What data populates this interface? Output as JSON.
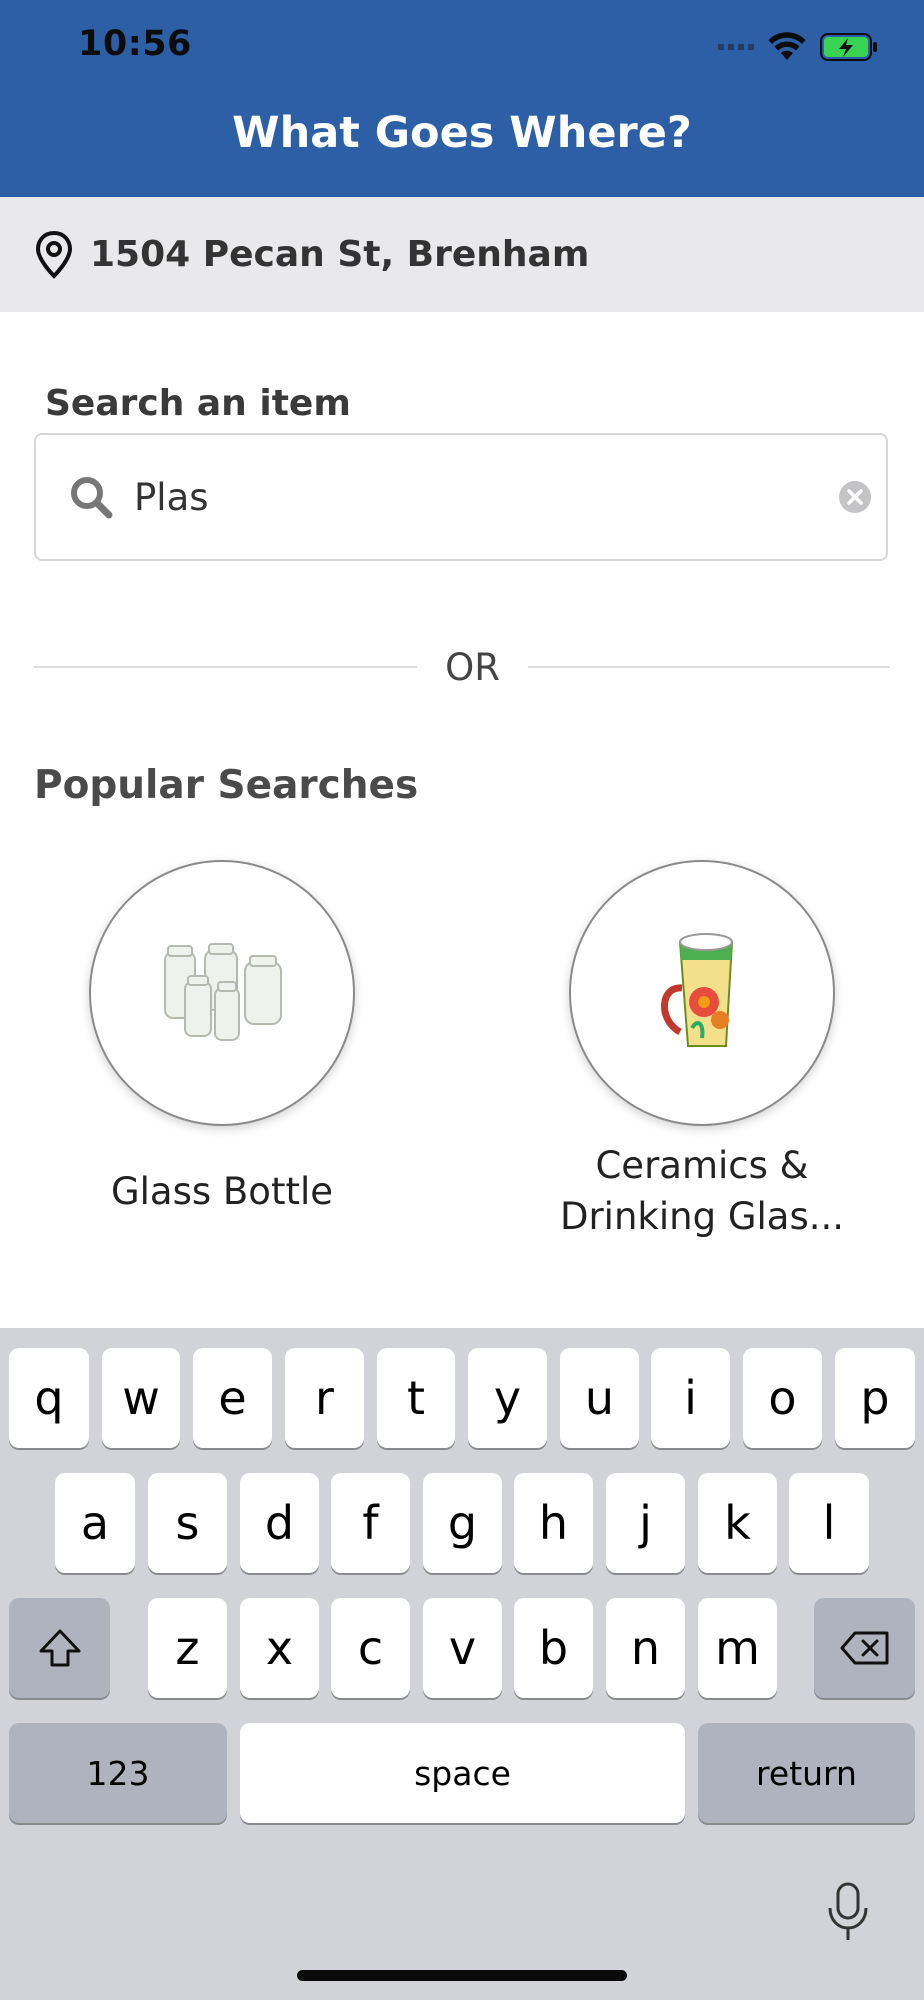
{
  "status_bar": {
    "time": "10:56"
  },
  "header": {
    "title": "What Goes Where?",
    "background_color": "#2d5fa6"
  },
  "location": {
    "address": "1504 Pecan St, Brenham",
    "icon": "location-pin-icon"
  },
  "search": {
    "label": "Search an item",
    "value": "Plas",
    "icon": "search-icon",
    "clear_icon": "clear-icon"
  },
  "divider": {
    "text": "OR"
  },
  "popular": {
    "title": "Popular Searches",
    "items": [
      {
        "label": "Glass Bottle",
        "image": "glass-jars"
      },
      {
        "label": "Ceramics & Drinking Glas...",
        "image": "ceramic-mug"
      }
    ]
  },
  "keyboard": {
    "row1": [
      "q",
      "w",
      "e",
      "r",
      "t",
      "y",
      "u",
      "i",
      "o",
      "p"
    ],
    "row2": [
      "a",
      "s",
      "d",
      "f",
      "g",
      "h",
      "j",
      "k",
      "l"
    ],
    "row3": [
      "z",
      "x",
      "c",
      "v",
      "b",
      "n",
      "m"
    ],
    "numbers_label": "123",
    "space_label": "space",
    "return_label": "return"
  }
}
